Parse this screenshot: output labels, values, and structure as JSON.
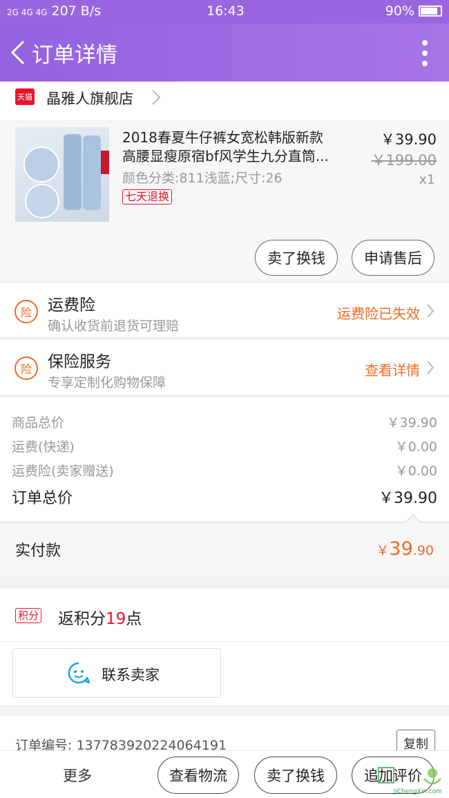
{
  "status_bar": {
    "signal": "2G 4G 4G",
    "speed": "207 B/s",
    "time": "16:43",
    "battery": "90%"
  },
  "header": {
    "title": "订单详情"
  },
  "store": {
    "badge": "天猫",
    "name": "晶雅人旗舰店"
  },
  "product": {
    "title_line1": "2018春夏牛仔裤女宽松韩版新款",
    "title_line2": "高腰显瘦原宿bf风学生九分直筒...",
    "spec": "颜色分类:811浅蓝;尺寸:26",
    "badge": "七天退换",
    "price": "￥39.90",
    "original_price": "￥199.00",
    "quantity": "x1",
    "buttons": {
      "sell": "卖了换钱",
      "after_sale": "申请售后"
    }
  },
  "insurance": [
    {
      "icon": "险",
      "title": "运费险",
      "subtitle": "确认收货前退货可理赔",
      "link": "运费险已失效"
    },
    {
      "icon": "险",
      "title": "保险服务",
      "subtitle": "专享定制化购物保障",
      "link": "查看详情"
    }
  ],
  "totals": {
    "goods_label": "商品总价",
    "goods_value": "￥39.90",
    "shipping_label": "运费(快递)",
    "shipping_value": "￥0.00",
    "shipping_ins_label": "运费险(卖家赠送)",
    "shipping_ins_value": "￥0.00",
    "order_total_label": "订单总价",
    "order_total_value": "￥39.90"
  },
  "paid": {
    "label": "实付款",
    "currency": "￥",
    "integer": "39",
    "decimal": ".90"
  },
  "points": {
    "badge": "积分",
    "prefix": "返积分",
    "number": "19",
    "suffix": "点"
  },
  "contact": {
    "label": "联系卖家"
  },
  "order": {
    "number_label": "订单编号:  137783920224064191",
    "copy": "复制"
  },
  "bottom_bar": {
    "more": "更多",
    "logistics": "查看物流",
    "sell": "卖了换钱",
    "review": "追加评价"
  },
  "watermark": {
    "text": "JiChengXin.com"
  },
  "colors": {
    "header": "#9a66e0",
    "accent": "#f06a24",
    "tmall_red": "#e8142d"
  }
}
